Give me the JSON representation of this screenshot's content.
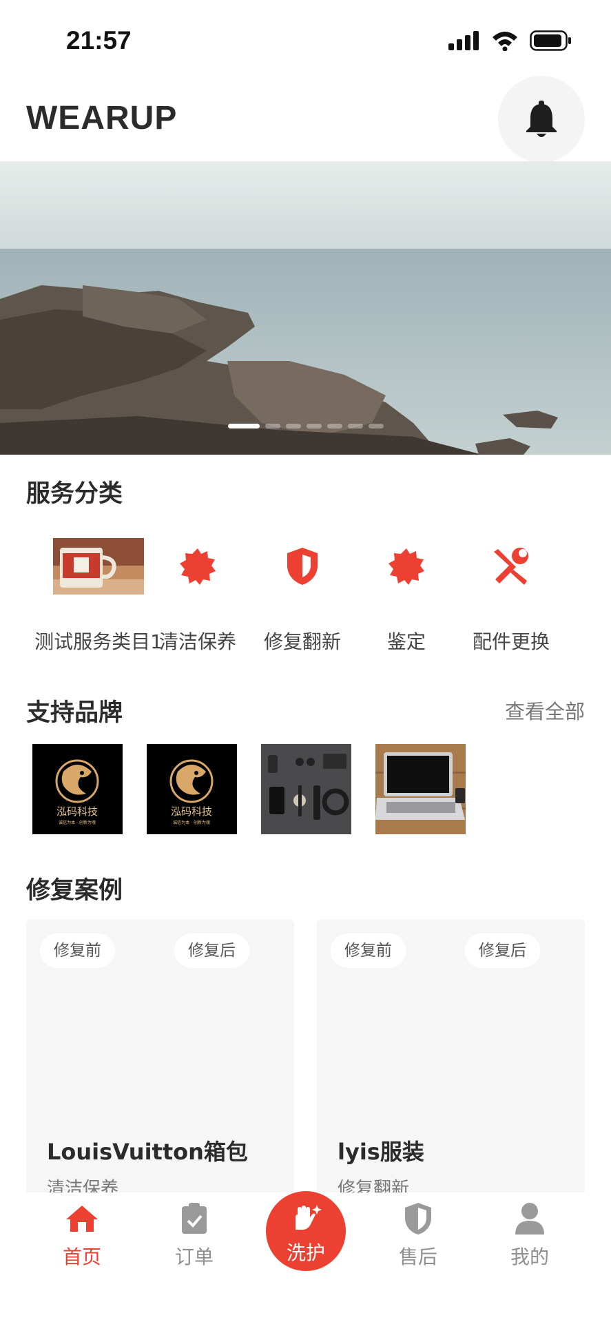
{
  "status": {
    "time": "21:57"
  },
  "header": {
    "title": "WEARUP"
  },
  "banner": {
    "dot_count": 7,
    "active_dot": 0
  },
  "services": {
    "title": "服务分类",
    "items": [
      {
        "label": "测试服务类目1",
        "icon": "mug-photo"
      },
      {
        "label": "清洁保养",
        "icon": "badge-icon"
      },
      {
        "label": "修复翻新",
        "icon": "shield-icon"
      },
      {
        "label": "鉴定",
        "icon": "badge-icon"
      },
      {
        "label": "配件更换",
        "icon": "tools-icon"
      }
    ]
  },
  "brands": {
    "title": "支持品牌",
    "view_all": "查看全部",
    "items": [
      {
        "name": "泓码科技",
        "tagline": "诚信为本 · 创新为魂",
        "kind": "logo"
      },
      {
        "name": "泓码科技",
        "tagline": "诚信为本 · 创新为魂",
        "kind": "logo"
      },
      {
        "kind": "flatlay-photo"
      },
      {
        "kind": "laptop-photo"
      }
    ]
  },
  "cases": {
    "title": "修复案例",
    "before_label": "修复前",
    "after_label": "修复后",
    "items": [
      {
        "title": "LouisVuitton箱包",
        "category": "清洁保养"
      },
      {
        "title": "lyis服装",
        "category": "修复翻新"
      }
    ]
  },
  "tabbar": {
    "items": [
      {
        "label": "首页",
        "icon": "home-icon",
        "active": true
      },
      {
        "label": "订单",
        "icon": "clipboard-check-icon",
        "active": false
      },
      {
        "label": "洗护",
        "icon": "hand-sparkle-icon",
        "active": false
      },
      {
        "label": "售后",
        "icon": "shield-half-icon",
        "active": false
      },
      {
        "label": "我的",
        "icon": "person-icon",
        "active": false
      }
    ]
  },
  "colors": {
    "accent": "#ec4132",
    "text": "#2b2b2b",
    "muted": "#8f8f8f"
  }
}
